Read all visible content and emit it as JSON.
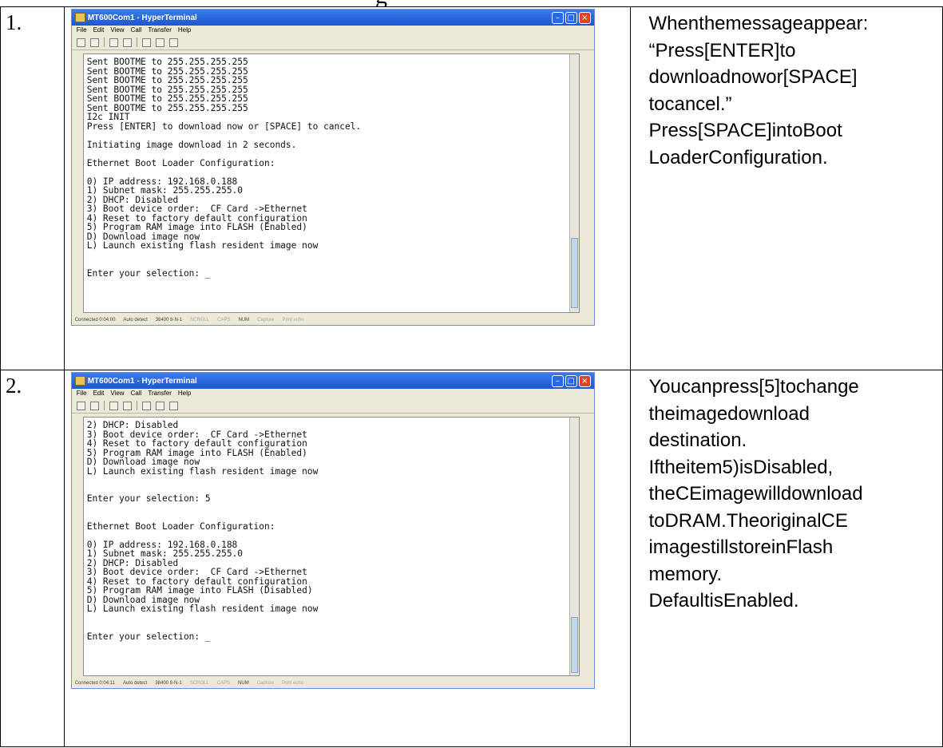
{
  "heading_fragment": "g",
  "rows": [
    {
      "number": "1.",
      "window": {
        "title": "MT600Com1 - HyperTerminal",
        "menu": [
          "File",
          "Edit",
          "View",
          "Call",
          "Transfer",
          "Help"
        ],
        "terminal_lines": [
          "Sent BOOTME to 255.255.255.255",
          "Sent BOOTME to 255.255.255.255",
          "Sent BOOTME to 255.255.255.255",
          "Sent BOOTME to 255.255.255.255",
          "Sent BOOTME to 255.255.255.255",
          "Sent BOOTME to 255.255.255.255",
          "I2c INIT",
          "Press [ENTER] to download now or [SPACE] to cancel.",
          "",
          "Initiating image download in 2 seconds.",
          "",
          "Ethernet Boot Loader Configuration:",
          "",
          "0) IP address: 192.168.0.188",
          "1) Subnet mask: 255.255.255.0",
          "2) DHCP: Disabled",
          "3) Boot device order:  CF Card ->Ethernet",
          "4) Reset to factory default configuration",
          "5) Program RAM image into FLASH (Enabled)",
          "D) Download image now",
          "L) Launch existing flash resident image now",
          "",
          "",
          "Enter your selection: _"
        ],
        "status": [
          "Connected 0:04:00",
          "Auto detect",
          "38400 8-N-1",
          "SCROLL",
          "CAPS",
          "NUM",
          "Capture",
          "Print echo"
        ]
      },
      "description": [
        "Whenthemessageappear:",
        "“Press[ENTER]to",
        "downloadnowor[SPACE]",
        "tocancel.”",
        "Press[SPACE]intoBoot",
        "LoaderConfiguration."
      ]
    },
    {
      "number": "2.",
      "window": {
        "title": "MT600Com1 - HyperTerminal",
        "menu": [
          "File",
          "Edit",
          "View",
          "Call",
          "Transfer",
          "Help"
        ],
        "terminal_lines": [
          "2) DHCP: Disabled",
          "3) Boot device order:  CF Card ->Ethernet",
          "4) Reset to factory default configuration",
          "5) Program RAM image into FLASH (Enabled)",
          "D) Download image now",
          "L) Launch existing flash resident image now",
          "",
          "",
          "Enter your selection: 5",
          "",
          "",
          "Ethernet Boot Loader Configuration:",
          "",
          "0) IP address: 192.168.0.188",
          "1) Subnet mask: 255.255.255.0",
          "2) DHCP: Disabled",
          "3) Boot device order:  CF Card ->Ethernet",
          "4) Reset to factory default configuration",
          "5) Program RAM image into FLASH (Disabled)",
          "D) Download image now",
          "L) Launch existing flash resident image now",
          "",
          "",
          "Enter your selection: _"
        ],
        "status": [
          "Connected 0:04:11",
          "Auto detect",
          "38400 8-N-1",
          "SCROLL",
          "CAPS",
          "NUM",
          "Capture",
          "Print echo"
        ]
      },
      "description": [
        "Youcanpress[5]tochange",
        "theimagedownload",
        "destination.",
        "Iftheitem5)isDisabled,",
        "theCEimagewilldownload",
        "toDRAM.TheoriginalCE",
        "imagestillstoreinFlash",
        "memory.",
        "DefaultisEnabled."
      ]
    }
  ]
}
